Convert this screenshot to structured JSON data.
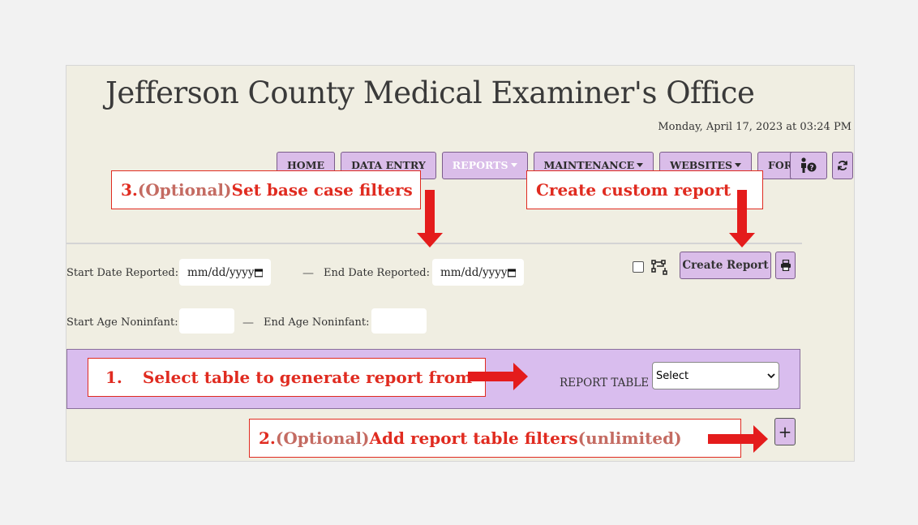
{
  "app": {
    "title": "Jefferson County Medical Examiner's Office",
    "datetime": "Monday, April 17, 2023 at 03:24 PM"
  },
  "nav": {
    "home": "HOME",
    "data_entry": "DATA ENTRY",
    "reports": "REPORTS",
    "maintenance": "MAINTENANCE",
    "websites": "WEBSITES",
    "forms": "FORMS",
    "help_icon": "person-help-icon",
    "refresh_icon": "refresh-icon"
  },
  "filters": {
    "start_date_label": "Start Date Reported:",
    "end_date_label": "End Date Reported:",
    "start_date_placeholder": "mm/dd/yyyy",
    "end_date_placeholder": "mm/dd/yyyy",
    "dash": "—",
    "start_age_label": "Start Age Noninfant:",
    "end_age_label": "End Age Noninfant:",
    "start_age_value": "",
    "end_age_value": ""
  },
  "actions": {
    "create_report": "Create Report",
    "checkbox_checked": false,
    "schema_icon": "schema-icon",
    "print_icon": "print-icon",
    "add_filter": "+"
  },
  "report_table": {
    "label": "REPORT TABLE",
    "selected": "Select"
  },
  "annotations": {
    "step3_prefix": "3. ",
    "step3_optional": "(Optional)",
    "step3_text": " Set base case filters",
    "custom": "Create custom report",
    "step1_num": "1.",
    "step1_text": "Select table to generate report from",
    "step2_prefix": "2. ",
    "step2_optional": "(Optional)",
    "step2_text": " Add report table filters ",
    "step2_suffix": "(unlimited)"
  },
  "colors": {
    "panel_bg": "#f0eee2",
    "button_bg": "#dabde9",
    "band_bg": "#d9bdee",
    "annotation_red": "#e02b20"
  }
}
